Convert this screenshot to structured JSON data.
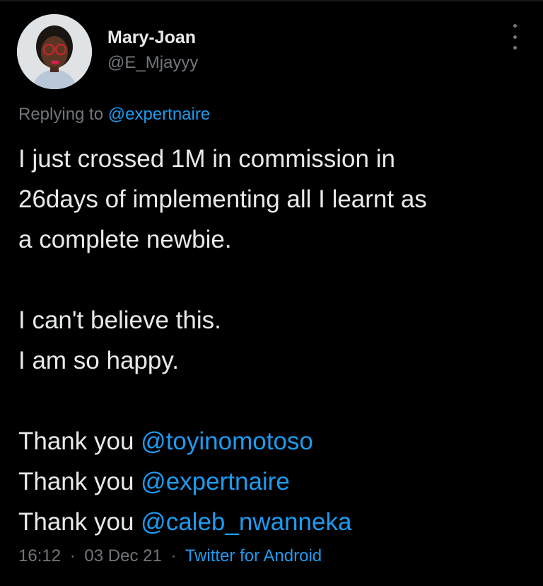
{
  "tweet": {
    "author": {
      "display_name": "Mary-Joan",
      "handle": "@E_Mjayyy"
    },
    "more_icon": "more-vertical-icon",
    "reply": {
      "prefix": "Replying to",
      "handle": "@expertnaire"
    },
    "text": {
      "line1": "I just crossed 1M in commission in",
      "line2": "26days of implementing all I learnt as",
      "line3": "a complete newbie.",
      "line4": "I can't believe this.",
      "line5": "I am so happy.",
      "thank_prefix": "Thank you",
      "mention1": "@toyinomotoso",
      "mention2": "@expertnaire",
      "mention3": "@caleb_nwanneka"
    },
    "meta": {
      "time": "16:12",
      "date": "03 Dec 21",
      "separator": "·",
      "source": "Twitter for Android"
    }
  },
  "colors": {
    "background": "#000000",
    "text": "#e7e9ea",
    "muted": "#71767b",
    "link": "#1d9bf0"
  }
}
